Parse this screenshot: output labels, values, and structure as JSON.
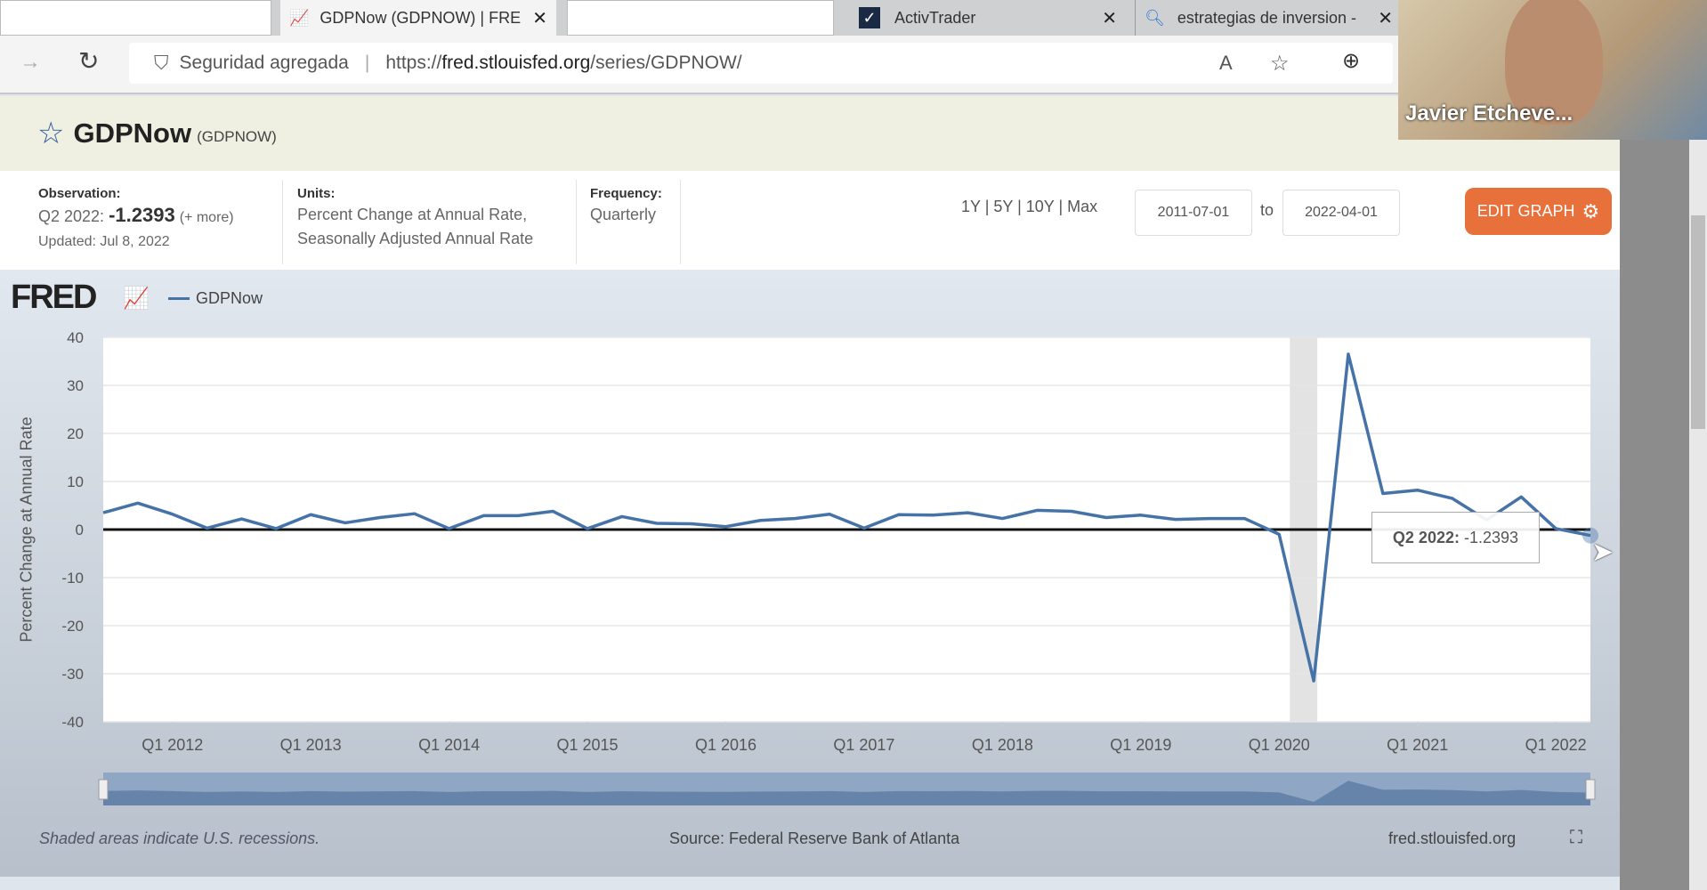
{
  "browser": {
    "tabs": [
      {
        "label": "GDPNow (GDPNOW) | FRE"
      },
      {
        "label": "ActivTrader"
      },
      {
        "label": "estrategias de inversion -"
      }
    ],
    "security_label": "Seguridad agregada",
    "url_prefix": "https://",
    "url_domain": "fred.stlouisfed.org",
    "url_path": "/series/GDPNOW/"
  },
  "video": {
    "participant": "Javier Etcheve..."
  },
  "series": {
    "title": "GDPNow",
    "code": "(GDPNOW)"
  },
  "info": {
    "observation_label": "Observation:",
    "observation_period": "Q2 2022:",
    "observation_value": "-1.2393",
    "more": "(+ more)",
    "updated": "Updated: Jul 8, 2022",
    "units_label": "Units:",
    "units_line1": "Percent Change at Annual Rate,",
    "units_line2": "Seasonally Adjusted Annual Rate",
    "frequency_label": "Frequency:",
    "frequency": "Quarterly"
  },
  "range": {
    "options": [
      "1Y",
      "5Y",
      "10Y",
      "Max"
    ],
    "from": "2011-07-01",
    "to_label": "to",
    "to": "2022-04-01"
  },
  "edit_graph": "EDIT GRAPH",
  "footer": {
    "note": "Shaded areas indicate U.S. recessions.",
    "source": "Source: Federal Reserve Bank of Atlanta",
    "site": "fred.stlouisfed.org"
  },
  "logo": "FRED",
  "chart_data": {
    "type": "line",
    "title": "",
    "legend": [
      "GDPNow"
    ],
    "legend_placement": "top-left",
    "ylabel": "Percent Change at Annual Rate",
    "xlabel": "",
    "ylim": [
      -40,
      40
    ],
    "yticks": [
      40,
      30,
      20,
      10,
      0,
      -10,
      -20,
      -30,
      -40
    ],
    "xticks": [
      "Q1 2012",
      "Q1 2013",
      "Q1 2014",
      "Q1 2015",
      "Q1 2016",
      "Q1 2017",
      "Q1 2018",
      "Q1 2019",
      "Q1 2020",
      "Q1 2021",
      "Q1 2022"
    ],
    "start": "2011Q3",
    "color": "#4572a7",
    "values": [
      3.5,
      5.5,
      3.2,
      0.3,
      2.2,
      0.2,
      3.1,
      1.4,
      2.5,
      3.3,
      0.2,
      2.9,
      2.9,
      3.8,
      0.2,
      2.7,
      1.3,
      1.2,
      0.6,
      1.9,
      2.3,
      3.2,
      0.3,
      3.1,
      3.0,
      3.5,
      2.3,
      4.0,
      3.8,
      2.5,
      3.0,
      2.1,
      2.3,
      2.3,
      -1.0,
      -31.5,
      36.5,
      7.5,
      8.2,
      6.5,
      2.0,
      6.8,
      0.2,
      -1.2393
    ],
    "recession": [
      "2020Q1",
      "2020Q2"
    ],
    "tooltip": {
      "label": "Q2 2022:",
      "value": "-1.2393"
    }
  }
}
